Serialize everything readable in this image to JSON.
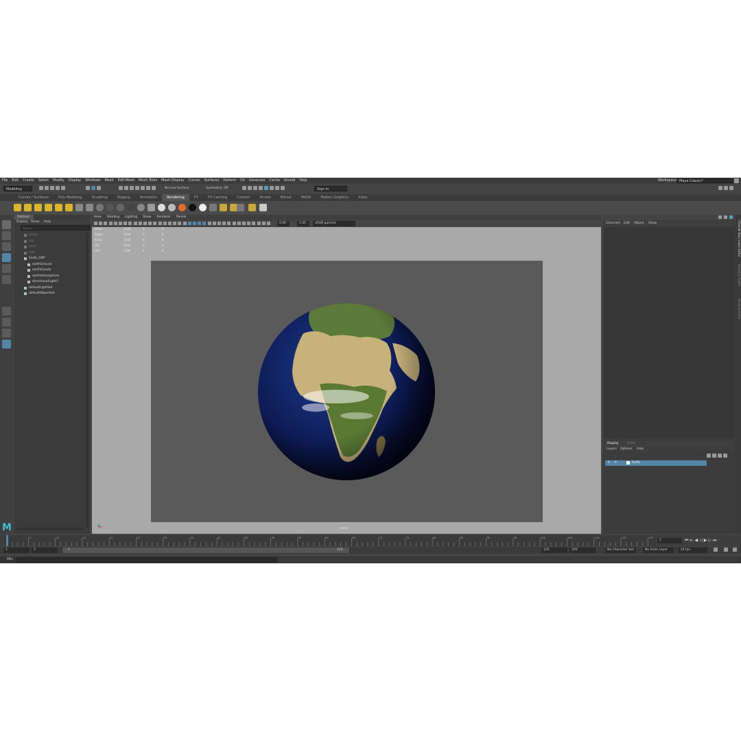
{
  "menus": [
    "File",
    "Edit",
    "Create",
    "Select",
    "Modify",
    "Display",
    "Windows",
    "Mesh",
    "Edit Mesh",
    "Mesh Tools",
    "Mesh Display",
    "Curves",
    "Surfaces",
    "Deform",
    "UV",
    "Generate",
    "Cache",
    "Arnold",
    "Help"
  ],
  "workspace": {
    "label": "Workspace :",
    "value": "Maya Classic*"
  },
  "toolbar": {
    "mode": "Modeling",
    "live_surface": "No Live Surface",
    "symmetry": "Symmetry: Off",
    "sign_in": "Sign In"
  },
  "shelf_tabs": [
    "Curves / Surfaces",
    "Poly Modeling",
    "Sculpting",
    "Rigging",
    "Animation",
    "Rendering",
    "FX",
    "FX Caching",
    "Custom",
    "Arnold",
    "Bifrost",
    "MASH",
    "Motion Graphics",
    "XGen"
  ],
  "shelf_active": "Rendering",
  "outliner": {
    "title": "Outliner",
    "menu": [
      "Display",
      "Show",
      "Help"
    ],
    "search_placeholder": "Search...",
    "items": [
      {
        "label": "persp",
        "dim": true,
        "indent": 0
      },
      {
        "label": "top",
        "dim": true,
        "indent": 0
      },
      {
        "label": "front",
        "dim": true,
        "indent": 0
      },
      {
        "label": "side",
        "dim": true,
        "indent": 0
      },
      {
        "label": "Earth_GRP",
        "dim": false,
        "indent": 0
      },
      {
        "label": "earthGround",
        "dim": false,
        "indent": 1
      },
      {
        "label": "earthClouds",
        "dim": false,
        "indent": 1
      },
      {
        "label": "earthAtmosphere",
        "dim": false,
        "indent": 1
      },
      {
        "label": "directionalLight1",
        "dim": false,
        "indent": 1
      },
      {
        "label": "defaultLightSet",
        "dim": false,
        "indent": 0
      },
      {
        "label": "defaultObjectSet",
        "dim": false,
        "indent": 0
      }
    ]
  },
  "viewport": {
    "menu": [
      "View",
      "Shading",
      "Lighting",
      "Show",
      "Renderer",
      "Panels"
    ],
    "exposure": "0.00",
    "gamma": "1.00",
    "color_space": "sRGB gamma",
    "camera_label": "persp",
    "hud": [
      {
        "label": "Verts:",
        "a": "1148",
        "b": "0",
        "c": "0"
      },
      {
        "label": "Edges:",
        "a": "2328",
        "b": "0",
        "c": "0"
      },
      {
        "label": "Faces:",
        "a": "1102",
        "b": "0",
        "c": "0"
      },
      {
        "label": "Tris:",
        "a": "2204",
        "b": "0",
        "c": "0"
      },
      {
        "label": "UVs:",
        "a": "1189",
        "b": "0",
        "c": "0"
      }
    ]
  },
  "channel_box": {
    "menu": [
      "Channels",
      "Edit",
      "Object",
      "Show"
    ],
    "side_tabs": [
      "Channel Box / Layer Editor",
      "Modeling Toolkit",
      "Attribute Editor"
    ]
  },
  "layer_editor": {
    "tabs": [
      "Display",
      "Anim"
    ],
    "menu": [
      "Layers",
      "Options",
      "Help"
    ],
    "layer": {
      "v": "V",
      "p": "P",
      "name": "Earth"
    }
  },
  "timeline": {
    "ticks": [
      "5",
      "10",
      "15",
      "20",
      "25",
      "30",
      "35",
      "40",
      "45",
      "50",
      "55",
      "60",
      "65",
      "70",
      "75",
      "80",
      "85",
      "90",
      "95",
      "100",
      "105",
      "110",
      "115",
      "120"
    ],
    "current_frame": "1"
  },
  "range": {
    "start": "1",
    "start2": "1",
    "slider_start": "1",
    "slider_end": "120",
    "end": "120",
    "end2": "200",
    "character_set": "No Character Set",
    "anim_layer": "No Anim Layer",
    "fps": "24 fps"
  },
  "command_line": {
    "label": "MEL"
  },
  "colors": {
    "accent": "#5285a6",
    "app_bg": "#444444",
    "viewport_bg": "#a9a9a9",
    "gate_bg": "#5a5a5a"
  }
}
